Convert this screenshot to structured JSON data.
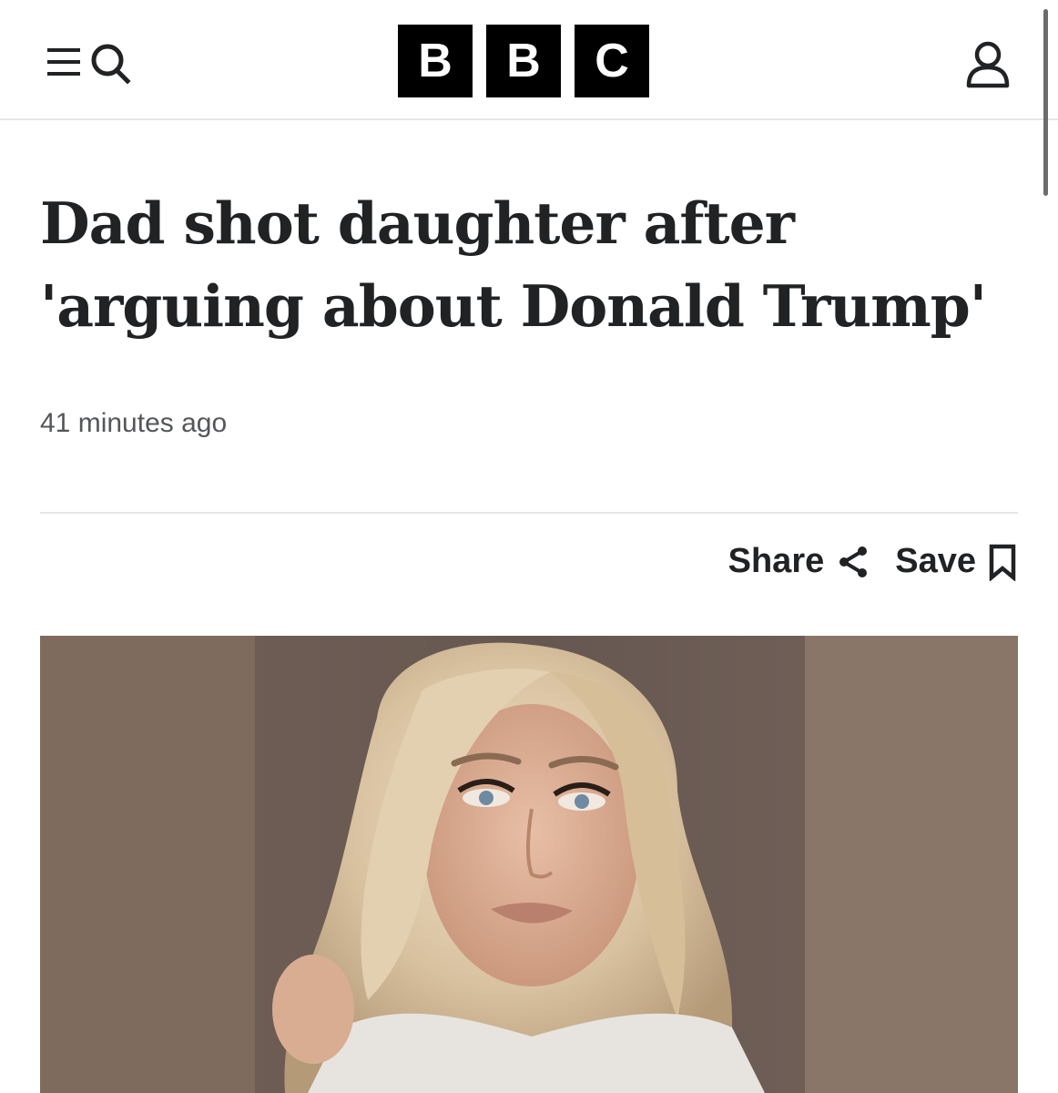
{
  "header": {
    "menu_icon": "menu-icon",
    "search_icon": "search-icon",
    "logo_letters": [
      "B",
      "B",
      "C"
    ],
    "account_icon": "account-icon"
  },
  "article": {
    "headline": "Dad shot daughter after 'arguing about Donald Trump'",
    "timestamp": "41 minutes ago",
    "share_label": "Share",
    "share_icon": "share-icon",
    "save_label": "Save",
    "save_icon": "bookmark-icon"
  },
  "colors": {
    "text": "#202224",
    "muted": "#545658",
    "divider": "#e6e6e6",
    "logo_bg": "#000000"
  }
}
